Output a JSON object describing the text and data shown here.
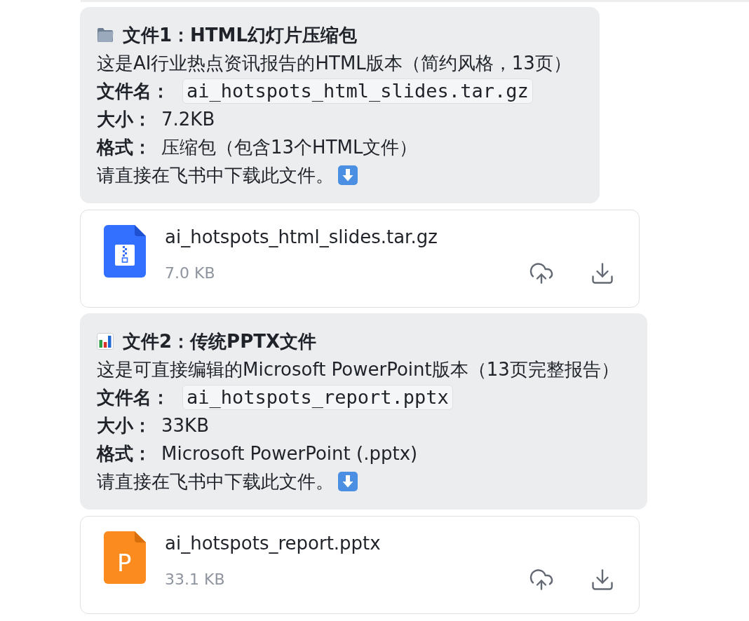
{
  "messages": [
    {
      "kind": "archive",
      "title": "文件1：HTML幻灯片压缩包",
      "description": "这是AI行业热点资讯报告的HTML版本（简约风格，13页）",
      "fields": [
        {
          "kind": "code",
          "label": "文件名：",
          "value": "ai_hotspots_html_slides.tar.gz"
        },
        {
          "kind": "text",
          "label": "大小：",
          "value": "7.2KB"
        },
        {
          "kind": "text",
          "label": "格式：",
          "value": "压缩包（包含13个HTML文件）"
        }
      ],
      "note": "请直接在飞书中下载此文件。",
      "attachment": {
        "kind": "archive",
        "name": "ai_hotspots_html_slides.tar.gz",
        "size": "7.0 KB"
      }
    },
    {
      "kind": "presentation",
      "title": "文件2：传统PPTX文件",
      "description": "这是可直接编辑的Microsoft PowerPoint版本（13页完整报告）",
      "fields": [
        {
          "kind": "code",
          "label": "文件名：",
          "value": "ai_hotspots_report.pptx"
        },
        {
          "kind": "text",
          "label": "大小：",
          "value": "33KB"
        },
        {
          "kind": "text",
          "label": "格式：",
          "value": "Microsoft PowerPoint (.pptx)"
        }
      ],
      "note": "请直接在飞书中下载此文件。",
      "attachment": {
        "kind": "presentation",
        "name": "ai_hotspots_report.pptx",
        "size": "33.1 KB",
        "icon_letter": "P"
      }
    }
  ]
}
